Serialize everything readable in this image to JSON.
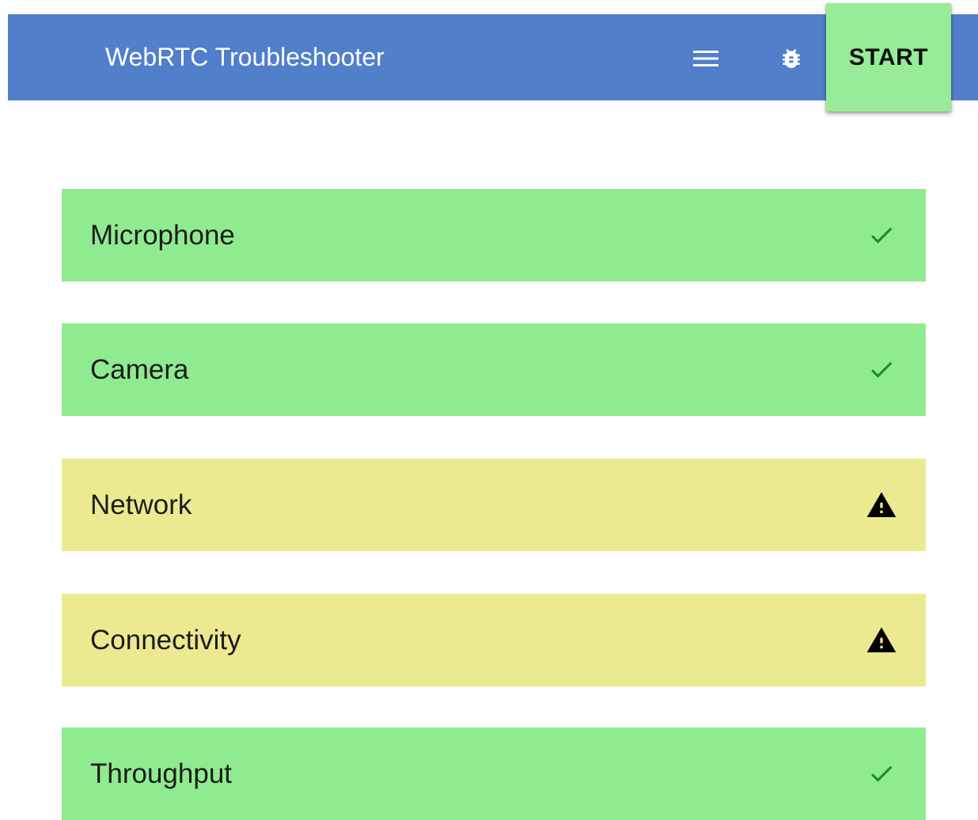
{
  "header": {
    "title": "WebRTC Troubleshooter",
    "menu_icon": "menu-icon",
    "bug_icon": "bug-icon",
    "start_label": "START",
    "colors": {
      "toolbar": "#517fca",
      "start_button": "#98ec98"
    }
  },
  "tests": [
    {
      "label": "Microphone",
      "status": "success",
      "icon": "check-icon",
      "color": "#8feb8f"
    },
    {
      "label": "Camera",
      "status": "success",
      "icon": "check-icon",
      "color": "#8feb8f"
    },
    {
      "label": "Network",
      "status": "warning",
      "icon": "warning-icon",
      "color": "#ebea90"
    },
    {
      "label": "Connectivity",
      "status": "warning",
      "icon": "warning-icon",
      "color": "#ebea90"
    },
    {
      "label": "Throughput",
      "status": "success",
      "icon": "check-icon",
      "color": "#8feb8f"
    }
  ]
}
